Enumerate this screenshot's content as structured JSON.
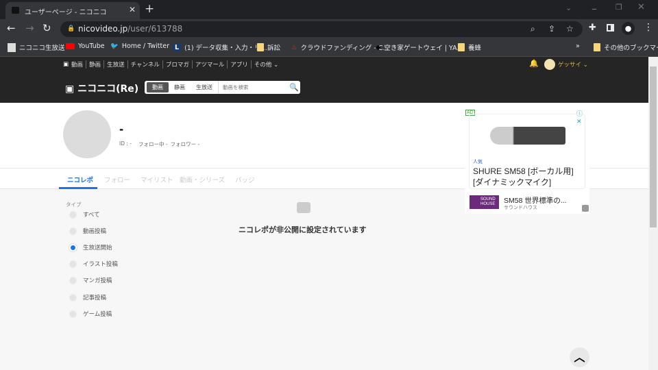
{
  "browser": {
    "tab_title": "ユーザーページ - ニコニコ",
    "url_domain": "nicovideo.jp",
    "url_path": "/user/613788",
    "bookmarks": [
      "ニコニコ生放送",
      "YouTube",
      "Home / Twitter",
      "(1) データ収集・入力・リ...",
      "訴訟",
      "クラウドファンディング - C...",
      "空き家ゲートウェイ | YA...",
      "養蜂"
    ],
    "other_bookmarks": "その他のブックマーク",
    "overflow": "»"
  },
  "site": {
    "nav": [
      "動画",
      "静画",
      "生放送",
      "チャンネル",
      "ブロマガ",
      "アツマール",
      "アプリ",
      "その他 ⌄"
    ],
    "user_name": "ゲッサイ ⌄",
    "logo": "ニコニコ(Re)",
    "search_tabs": [
      "動画",
      "静画",
      "生放送"
    ],
    "search_placeholder": "動画を検索"
  },
  "profile": {
    "name": "-",
    "id": "ID : -",
    "following": "フォロー中 -",
    "followers": "フォロワー -"
  },
  "tabs": [
    "ニコレポ",
    "フォロー",
    "マイリスト",
    "動画・シリーズ",
    "バッジ"
  ],
  "filter": {
    "label": "タイプ",
    "options": [
      "すべて",
      "動画投稿",
      "生放送開始",
      "イラスト投稿",
      "マンガ投稿",
      "記事投稿",
      "ゲーム投稿"
    ],
    "selected": "生放送開始"
  },
  "message": "ニコレポが非公開に設定されています",
  "ad": {
    "badge": "AD",
    "tag": "人気",
    "title": "SHURE SM58 [ボーカル用] [ダイナミックマイク]",
    "sub_title": "SM58 世界標準の...",
    "advertiser": "サウンドハウス",
    "logo_text": "SOUND HOUSE"
  },
  "colors": {
    "accent": "#1a73e8",
    "header": "#252525"
  }
}
